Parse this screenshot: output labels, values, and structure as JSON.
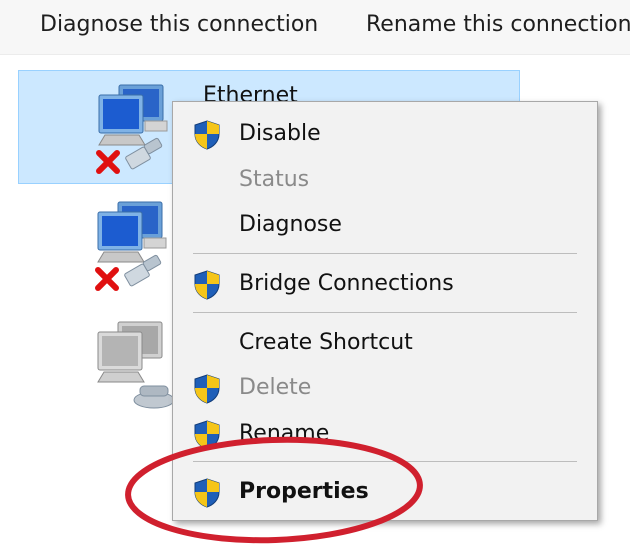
{
  "toolbar": {
    "diagnose_label": "Diagnose this connection",
    "rename_label": "Rename this connection"
  },
  "connections": [
    {
      "name": "Ethernet",
      "status": "disconnected",
      "selected": true
    },
    {
      "name": "",
      "status": "disconnected",
      "selected": false
    },
    {
      "name": "",
      "status": "dialup",
      "selected": false
    }
  ],
  "context_menu": {
    "items": [
      {
        "label": "Disable",
        "shield": true,
        "disabled": false,
        "bold": false
      },
      {
        "label": "Status",
        "shield": false,
        "disabled": true,
        "bold": false
      },
      {
        "label": "Diagnose",
        "shield": false,
        "disabled": false,
        "bold": false
      },
      {
        "label": "Bridge Connections",
        "shield": true,
        "disabled": false,
        "bold": false
      },
      {
        "label": "Create Shortcut",
        "shield": false,
        "disabled": false,
        "bold": false
      },
      {
        "label": "Delete",
        "shield": true,
        "disabled": true,
        "bold": false
      },
      {
        "label": "Rename",
        "shield": true,
        "disabled": false,
        "bold": false
      },
      {
        "label": "Properties",
        "shield": true,
        "disabled": false,
        "bold": true
      }
    ]
  },
  "annotation": {
    "highlight_color": "#d0202e",
    "target": "Properties"
  },
  "colors": {
    "selection_fill": "#cce8ff",
    "selection_border": "#99d1ff",
    "menu_bg": "#f2f2f2",
    "error_x": "#e01010",
    "shield_blue": "#1f5fb8",
    "shield_yellow": "#f5c518"
  },
  "icons": [
    "network-computer-icon",
    "error-x-icon",
    "network-cable-icon",
    "uac-shield-icon",
    "dialup-phone-icon"
  ]
}
